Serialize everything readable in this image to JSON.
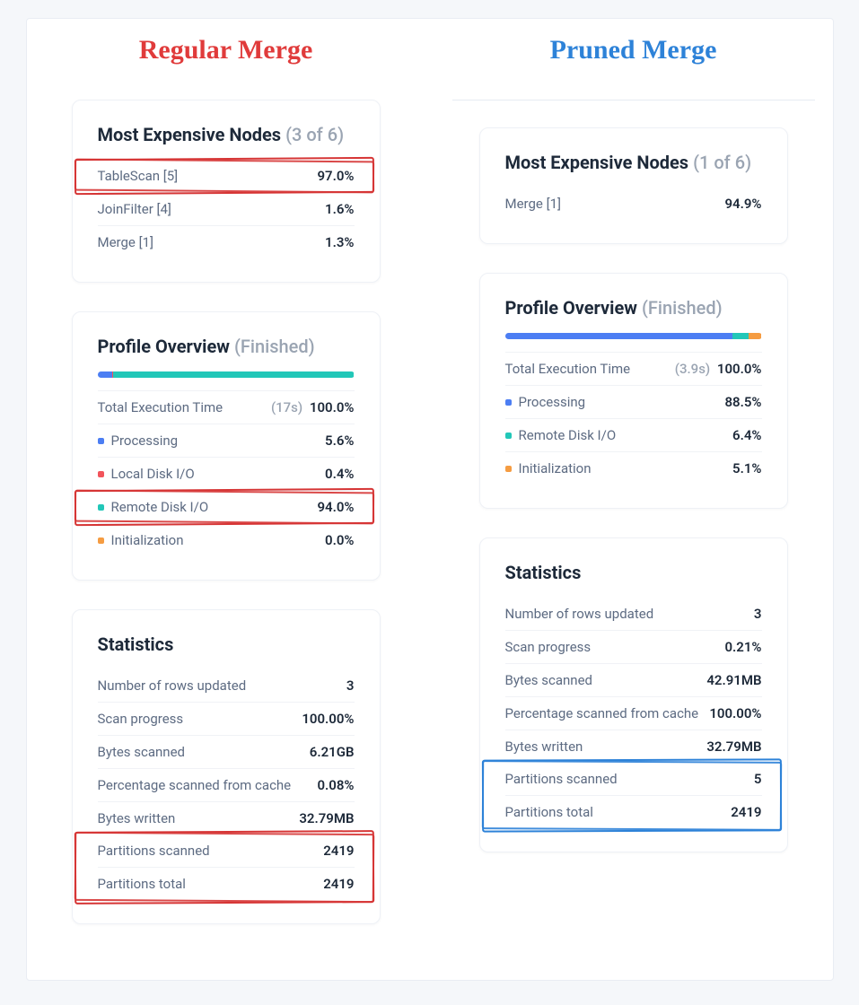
{
  "left": {
    "title": "Regular Merge",
    "expensive": {
      "title": "Most Expensive Nodes",
      "count": "(3 of 6)",
      "rows": [
        {
          "label": "TableScan [5]",
          "value": "97.0%"
        },
        {
          "label": "JoinFilter [4]",
          "value": "1.6%"
        },
        {
          "label": "Merge [1]",
          "value": "1.3%"
        }
      ]
    },
    "profile": {
      "title": "Profile Overview",
      "status": "(Finished)",
      "bar": [
        {
          "color": "blue",
          "pct": 5.6
        },
        {
          "color": "red",
          "pct": 0.4
        },
        {
          "color": "teal",
          "pct": 94.0
        },
        {
          "color": "orange",
          "pct": 0.0
        }
      ],
      "total_label": "Total Execution Time",
      "total_paren": "(17s)",
      "total_value": "100.0%",
      "rows": [
        {
          "color": "blue",
          "label": "Processing",
          "value": "5.6%"
        },
        {
          "color": "red",
          "label": "Local Disk I/O",
          "value": "0.4%"
        },
        {
          "color": "teal",
          "label": "Remote Disk I/O",
          "value": "94.0%"
        },
        {
          "color": "orange",
          "label": "Initialization",
          "value": "0.0%"
        }
      ]
    },
    "stats": {
      "title": "Statistics",
      "rows": [
        {
          "label": "Number of rows updated",
          "value": "3"
        },
        {
          "label": "Scan progress",
          "value": "100.00%"
        },
        {
          "label": "Bytes scanned",
          "value": "6.21GB"
        },
        {
          "label": "Percentage scanned from cache",
          "value": "0.08%"
        },
        {
          "label": "Bytes written",
          "value": "32.79MB"
        },
        {
          "label": "Partitions scanned",
          "value": "2419"
        },
        {
          "label": "Partitions total",
          "value": "2419"
        }
      ]
    }
  },
  "right": {
    "title": "Pruned Merge",
    "expensive": {
      "title": "Most Expensive Nodes",
      "count": "(1 of 6)",
      "rows": [
        {
          "label": "Merge [1]",
          "value": "94.9%"
        }
      ]
    },
    "profile": {
      "title": "Profile Overview",
      "status": "(Finished)",
      "bar": [
        {
          "color": "blue",
          "pct": 88.5
        },
        {
          "color": "teal",
          "pct": 6.4
        },
        {
          "color": "orange",
          "pct": 5.1
        }
      ],
      "total_label": "Total Execution Time",
      "total_paren": "(3.9s)",
      "total_value": "100.0%",
      "rows": [
        {
          "color": "blue",
          "label": "Processing",
          "value": "88.5%"
        },
        {
          "color": "teal",
          "label": "Remote Disk I/O",
          "value": "6.4%"
        },
        {
          "color": "orange",
          "label": "Initialization",
          "value": "5.1%"
        }
      ]
    },
    "stats": {
      "title": "Statistics",
      "rows": [
        {
          "label": "Number of rows updated",
          "value": "3"
        },
        {
          "label": "Scan progress",
          "value": "0.21%"
        },
        {
          "label": "Bytes scanned",
          "value": "42.91MB"
        },
        {
          "label": "Percentage scanned from cache",
          "value": "100.00%"
        },
        {
          "label": "Bytes written",
          "value": "32.79MB"
        },
        {
          "label": "Partitions scanned",
          "value": "5"
        },
        {
          "label": "Partitions total",
          "value": "2419"
        }
      ]
    }
  }
}
